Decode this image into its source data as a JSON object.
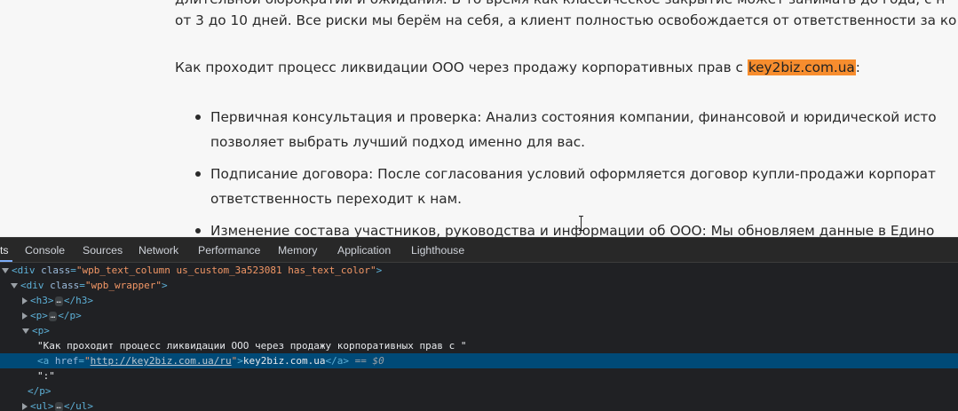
{
  "page": {
    "cut_line": "длительной бюрократии и ожидания. В то время как классическое закрытие может занимать до года, с н",
    "line2": "от 3 до 10 дней. Все риски мы берём на себя, а клиент полностью освобождается от ответственности за ко",
    "intro_text": "Как проходит процесс ликвидации ООО через продажу корпоративных прав с ",
    "intro_link": "key2biz.com.ua",
    "intro_suffix": ":",
    "steps": [
      {
        "line1": "Первичная консультация и проверка: Анализ состояния компании, финансовой и юридической исто",
        "line2": "позволяет выбрать лучший подход именно для вас."
      },
      {
        "line1": "Подписание договора: После согласования условий оформляется договор купли-продажи корпорат",
        "line2": "ответственность переходит к нам."
      },
      {
        "line1": "Изменение состава участников, руководства и информации об ООО: Мы обновляем данные в Едино",
        "line2": ""
      }
    ]
  },
  "devtools": {
    "tabs": [
      {
        "label": "ts",
        "active": true
      },
      {
        "label": "Console"
      },
      {
        "label": "Sources"
      },
      {
        "label": "Network"
      },
      {
        "label": "Performance"
      },
      {
        "label": "Memory"
      },
      {
        "label": "Application"
      },
      {
        "label": "Lighthouse"
      }
    ],
    "dom": {
      "row1": {
        "tag": "div",
        "attr": "class",
        "value": "wpb_text_column us_custom_3a523081 has_text_color"
      },
      "row2": {
        "tag": "div",
        "attr": "class",
        "value": "wpb_wrapper"
      },
      "row3": {
        "open": "<h3>",
        "close": "</h3>"
      },
      "row4": {
        "open": "<p>",
        "close": "</p>"
      },
      "row5": {
        "open": "<p>"
      },
      "row6": {
        "text": "\"Как проходит процесс ликвидации ООО через продажу корпоративных прав с \""
      },
      "row7": {
        "open": "<a ",
        "attr": "href",
        "value": "http://key2biz.com.ua/ru",
        "content": "key2biz.com.ua",
        "close": "</a>",
        "eq": "== $0"
      },
      "row8": {
        "text": "\":\""
      },
      "row9": {
        "close": "</p>"
      },
      "row10": {
        "open": "<ul>",
        "close": "</ul>"
      }
    },
    "ellipsis": "…"
  }
}
